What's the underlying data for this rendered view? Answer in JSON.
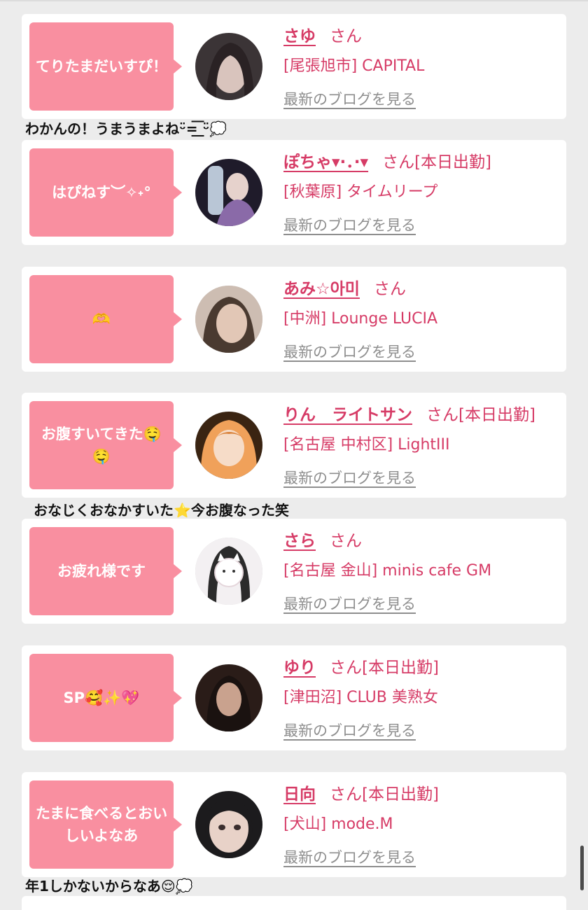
{
  "blog_link_label": "最新のブログを見る",
  "san_label": "さん",
  "cards": [
    {
      "message": "てりたまだいすぴ！",
      "name": "さゆ",
      "status": "",
      "shop": "[尾張旭市] CAPITAL",
      "avatar_icon": "avatar-photo-dark-hair",
      "avatar_colors": [
        "#3b3436",
        "#d9c4bd"
      ]
    },
    {
      "message": "はぴねす︶✧˖°",
      "name": "ぽちゃ▾·．·▾",
      "status": "[本日出勤]",
      "shop": "[秋葉原] タイムリープ",
      "avatar_icon": "avatar-photo-night",
      "avatar_colors": [
        "#1f1b2a",
        "#8a6aa8"
      ]
    },
    {
      "message": "🫶",
      "name": "あみ☆아미",
      "status": "",
      "shop": "[中洲] Lounge LUCIA",
      "avatar_icon": "avatar-photo-brown-hair",
      "avatar_colors": [
        "#4a3a30",
        "#e2c7b6"
      ]
    },
    {
      "message": "お腹すいてきた🤤🤤",
      "name": "りん　ライトサン",
      "status": "[本日出勤]",
      "shop": "[名古屋 中村区] LightIII",
      "avatar_icon": "avatar-illustration-orange-hair",
      "avatar_colors": [
        "#7a3b12",
        "#f0a15a"
      ]
    },
    {
      "message": "お疲れ様です",
      "name": "さら",
      "status": "",
      "shop": "[名古屋 金山] minis cafe GM",
      "avatar_icon": "avatar-photo-cat-mask",
      "avatar_colors": [
        "#f3f0f2",
        "#2b2b2b"
      ]
    },
    {
      "message": "SP🥰✨💖",
      "name": "ゆり",
      "status": "[本日出勤]",
      "shop": "[津田沼] CLUB 美熟女",
      "avatar_icon": "avatar-photo-dark-room",
      "avatar_colors": [
        "#2a1c18",
        "#c9a28e"
      ]
    },
    {
      "message": "たまに食べるとおいしいよなあ",
      "name": "日向",
      "status": "[本日出勤]",
      "shop": "[犬山] mode.M",
      "avatar_icon": "avatar-photo-selfie",
      "avatar_colors": [
        "#1c1b1d",
        "#e8d2c8"
      ]
    }
  ],
  "comments": [
    "わかんの！うまうまよねᵕ̈=͟͟͞͞ ᵕ̈💭",
    "おなじくおなかすいた⭐️今お腹なった笑",
    "年1しかないからなあ😌💭"
  ]
}
